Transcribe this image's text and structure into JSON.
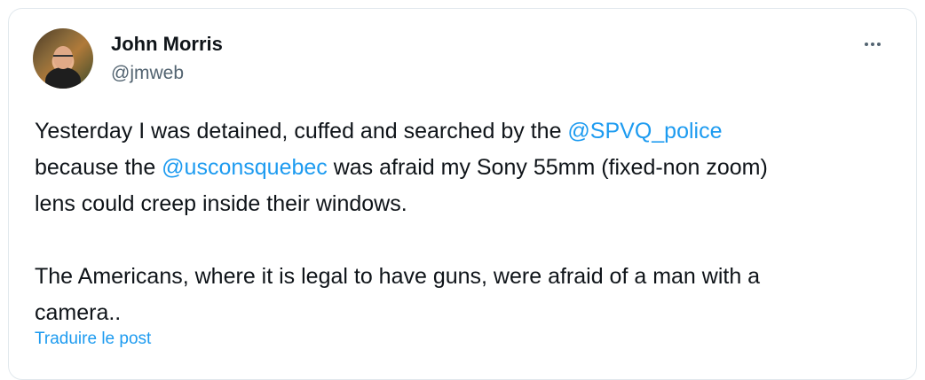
{
  "tweet": {
    "author_name": "John Morris",
    "author_handle": "@jmweb",
    "more_icon": "more-horizontal-icon",
    "line1_pre": "Yesterday I was detained, cuffed and searched by the ",
    "mention1": "@SPVQ_police",
    "line2_pre": "\nbecause the ",
    "mention2": "@usconsquebec",
    "line2_post": " was afraid my Sony 55mm (fixed-non zoom)\nlens could creep inside their windows.\n\nThe Americans, where it is legal to have guns, were afraid of a man with a\ncamera..",
    "translate_label": "Traduire le post",
    "colors": {
      "link": "#1d9bf0",
      "text": "#0f1419",
      "secondary": "#536471"
    }
  }
}
